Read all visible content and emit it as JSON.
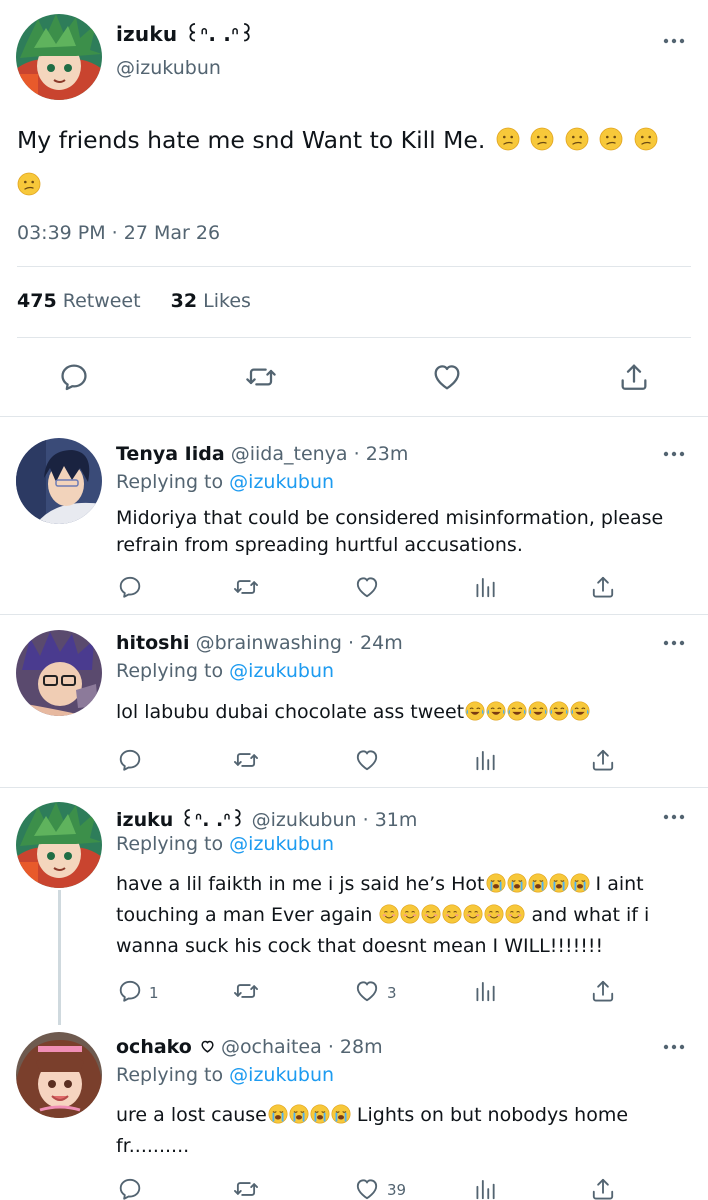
{
  "main_tweet": {
    "name": "izuku ꒰ᐢ. .ᐢ꒱",
    "handle": "@izukubun",
    "text": "My friends hate me snd Want to Kill Me.",
    "emoji": "confused-face",
    "timestamp": "03:39 PM · 27 Mar 26",
    "retweet_count": "475",
    "retweet_label": "Retweet",
    "likes_count": "32",
    "likes_label": "Likes"
  },
  "replies": [
    {
      "name": "Tenya Iida",
      "handle": "@iida_tenya",
      "time": "· 23m",
      "replying_prefix": "Replying to",
      "replying_to": "@izukubun",
      "text": "Midoriya that could be considered misinformation, please refrain from spreading hurtful accusations.",
      "reply_count": "",
      "like_count": ""
    },
    {
      "name": "hitoshi",
      "handle": "@brainwashing",
      "time": "· 24m",
      "replying_prefix": "Replying to",
      "replying_to": "@izukubun",
      "text": "lol labubu dubai chocolate ass tweet",
      "emoji": "face-with-tears-of-joy",
      "reply_count": "",
      "like_count": ""
    },
    {
      "name": "izuku ꒰ᐢ. .ᐢ꒱",
      "handle": "@izukubun",
      "time": "· 31m",
      "replying_prefix": "Replying to",
      "replying_to": "@izukubun",
      "text_part1": "have a lil faikth in me i js said he’s Hot",
      "text_part2": "I aint touching a man Ever again",
      "text_part3": "and what if i wanna suck his cock that doesnt mean I WILL!!!!!!!",
      "emoji_a": "loudly-crying-face",
      "emoji_b": "smiling-face-with-smiling-eyes",
      "reply_count": "1",
      "like_count": "3"
    },
    {
      "name": "ochako",
      "name_icon": "heart-outline",
      "handle": "@ochaitea",
      "time": "· 28m",
      "replying_prefix": "Replying to",
      "replying_to": "@izukubun",
      "text_part1": "ure a lost cause",
      "text_part2": "Lights on but nobodys home fr..........",
      "emoji": "loudly-crying-face",
      "reply_count": "",
      "like_count": "39"
    }
  ],
  "colors": {
    "text": "#0f1419",
    "secondary": "#536471",
    "link": "#1d9bf0",
    "divider": "#e1e6ea"
  }
}
